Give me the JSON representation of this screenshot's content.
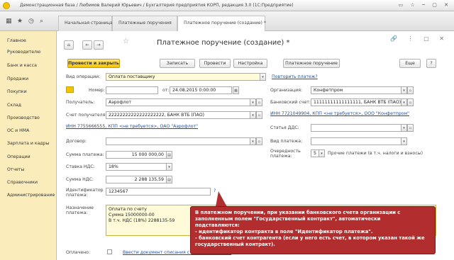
{
  "window": {
    "title": "Демонстрационная база / Любимов Валерий Юрьевич / Бухгалтерия предприятия КОРП, редакция 3.0  (1С:Предприятие)"
  },
  "tabs": [
    {
      "label": "Начальная страница"
    },
    {
      "label": "Платежные поручения"
    },
    {
      "label": "Платежное поручение (создание) *"
    }
  ],
  "sidebar": {
    "items": [
      "Главное",
      "Руководителю",
      "Банк и касса",
      "Продажи",
      "Покупки",
      "Склад",
      "Производство",
      "ОС и НМА",
      "Зарплата и кадры",
      "Операции",
      "Отчеты",
      "Справочники",
      "Администрирование"
    ]
  },
  "form": {
    "title": "Платежное поручение (создание) *",
    "buttons": {
      "post_close": "Провести и закрыть",
      "save": "Записать",
      "post": "Провести",
      "settings": "Настройка",
      "print": "Платежное поручение",
      "more": "Еще",
      "help": "?"
    },
    "op_type": {
      "label": "Вид операции:",
      "value": "Оплата поставщику"
    },
    "repeat_link": "Повторить платеж?",
    "number": {
      "label": "Номер:",
      "value": ""
    },
    "date": {
      "label": "от:",
      "value": "24.08.2015  0:00:00"
    },
    "org": {
      "label": "Организация:",
      "value": "Конфетпром"
    },
    "recipient": {
      "label": "Получатель:",
      "value": "Аэрофлот"
    },
    "bank_acc": {
      "label": "Банковский счет:",
      "value": "11111111111111111, БАНК ВТБ (ПАО)"
    },
    "org_inn": "ИНН 7721049904, КПП <не требуется>, ООО \"Конфетпром\"",
    "recipient_acc": {
      "label": "Счет получателя:",
      "value": "22222222222222222222, БАНК ВТБ (ПАО)"
    },
    "recipient_inn": "ИНН 7755666555, КПП <не требуется>, ОАО \"Аэрофлот\"",
    "dds": {
      "label": "Статья ДДС:",
      "value": ""
    },
    "contract": {
      "label": "Договор:",
      "value": ""
    },
    "payment_type": {
      "label": "Вид платежа:",
      "value": ""
    },
    "amount": {
      "label": "Сумма платежа:",
      "value": "15 000 000,00"
    },
    "priority": {
      "label": "Очередность платежа:",
      "value": "5",
      "hint": "Прочие платежи (в т.ч. налоги и взносы)"
    },
    "vat_rate": {
      "label": "Ставка НДС:",
      "value": "18%"
    },
    "vat_amount": {
      "label": "Сумма НДС:",
      "value": "2 288 135,59"
    },
    "payment_id": {
      "label": "Идентификатор платежа:",
      "value": "1234567"
    },
    "purpose": {
      "label": "Назначение платежа:",
      "lines": [
        "Оплата по счету",
        "Сумма 15000000-00",
        "В т.ч. НДС  (18%) 2288135-59"
      ]
    },
    "paid": {
      "label": "Оплачено:",
      "link": "Ввести документ списания с расчетного счета"
    }
  },
  "callout": {
    "lines": [
      "В платежном поручении, при указании банковского счета организации с",
      "заполненным полем \"Государственный контракт\", автоматически",
      "подставляются:",
      "- идентификатор контракта в поле \"Идентификатор платежа\".",
      "- банковский счет контрагента (если у него есть счет, в котором указан такой же",
      "государственный контракт)."
    ]
  }
}
